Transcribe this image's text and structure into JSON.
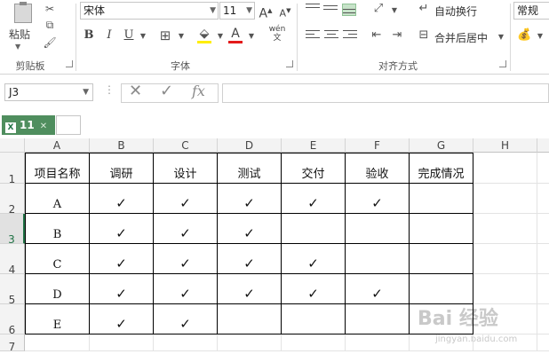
{
  "ribbon": {
    "clipboard": {
      "paste_label": "粘贴",
      "group_label": "剪贴板"
    },
    "font": {
      "name": "宋体",
      "size": "11",
      "group_label": "字体",
      "bold": "B",
      "italic": "I",
      "underline": "U",
      "grow": "A",
      "shrink": "A",
      "wen": "wén"
    },
    "alignment": {
      "group_label": "对齐方式",
      "wrap_label": "自动换行",
      "merge_label": "合并后居中"
    },
    "number": {
      "format": "常规"
    }
  },
  "formula_bar": {
    "name_box": "J3",
    "fx": "fx",
    "cancel": "✕",
    "enter": "✓",
    "value": ""
  },
  "workbook_tab": {
    "name": "11",
    "badge": "X",
    "close": "✕"
  },
  "columns": [
    "A",
    "B",
    "C",
    "D",
    "E",
    "F",
    "G",
    "H"
  ],
  "rows": [
    "1",
    "2",
    "3",
    "4",
    "5",
    "6",
    "7"
  ],
  "headers": [
    "项目名称",
    "调研",
    "设计",
    "测试",
    "交付",
    "验收",
    "完成情况"
  ],
  "table": [
    [
      "A",
      "✓",
      "✓",
      "✓",
      "✓",
      "✓",
      ""
    ],
    [
      "B",
      "✓",
      "✓",
      "✓",
      "",
      "",
      ""
    ],
    [
      "C",
      "✓",
      "✓",
      "✓",
      "✓",
      "",
      ""
    ],
    [
      "D",
      "✓",
      "✓",
      "✓",
      "✓",
      "✓",
      ""
    ],
    [
      "E",
      "✓",
      "✓",
      "",
      "",
      "",
      ""
    ]
  ],
  "watermark": {
    "main": "Bai 经验",
    "sub": "jingyan.baidu.com"
  },
  "colors": {
    "accent": "#217346",
    "tab": "#4f8e5e",
    "font_color_bar": "#e31a1a",
    "fill_color_bar": "#ffee00"
  }
}
